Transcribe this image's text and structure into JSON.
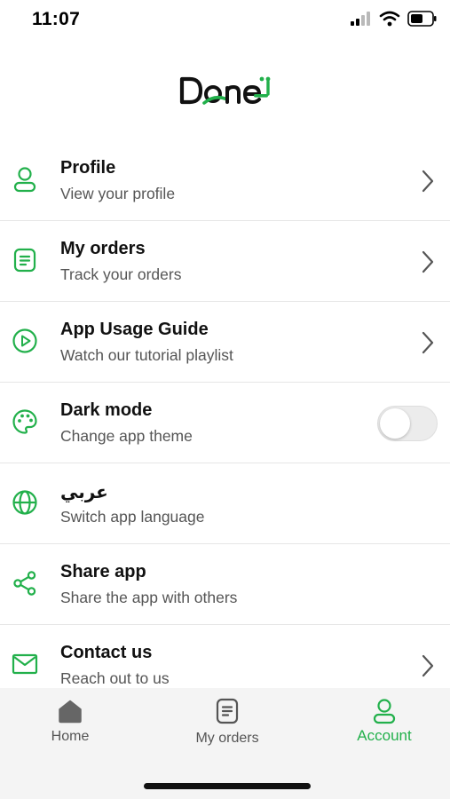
{
  "status_bar": {
    "time": "11:07"
  },
  "brand": {
    "name": "Done",
    "accent_color": "#22b04b"
  },
  "menu": [
    {
      "id": "profile",
      "title": "Profile",
      "subtitle": "View your profile",
      "icon": "person-icon",
      "trailing": "chevron"
    },
    {
      "id": "my-orders",
      "title": "My orders",
      "subtitle": "Track your orders",
      "icon": "document-icon",
      "trailing": "chevron"
    },
    {
      "id": "app-usage-guide",
      "title": "App Usage Guide",
      "subtitle": "Watch our tutorial playlist",
      "icon": "play-circle-icon",
      "trailing": "chevron"
    },
    {
      "id": "dark-mode",
      "title": "Dark mode",
      "subtitle": "Change app theme",
      "icon": "palette-icon",
      "trailing": "toggle",
      "toggle_on": false
    },
    {
      "id": "language",
      "title": "عربي",
      "subtitle": "Switch app language",
      "icon": "globe-icon",
      "trailing": "none"
    },
    {
      "id": "share-app",
      "title": "Share app",
      "subtitle": "Share the app with others",
      "icon": "share-icon",
      "trailing": "none"
    },
    {
      "id": "contact-us",
      "title": "Contact us",
      "subtitle": "Reach out to us",
      "icon": "mail-icon",
      "trailing": "chevron"
    }
  ],
  "tabbar": {
    "active": "account",
    "tabs": [
      {
        "id": "home",
        "label": "Home",
        "icon": "home-icon"
      },
      {
        "id": "my-orders",
        "label": "My orders",
        "icon": "document-icon"
      },
      {
        "id": "account",
        "label": "Account",
        "icon": "person-icon"
      }
    ]
  }
}
